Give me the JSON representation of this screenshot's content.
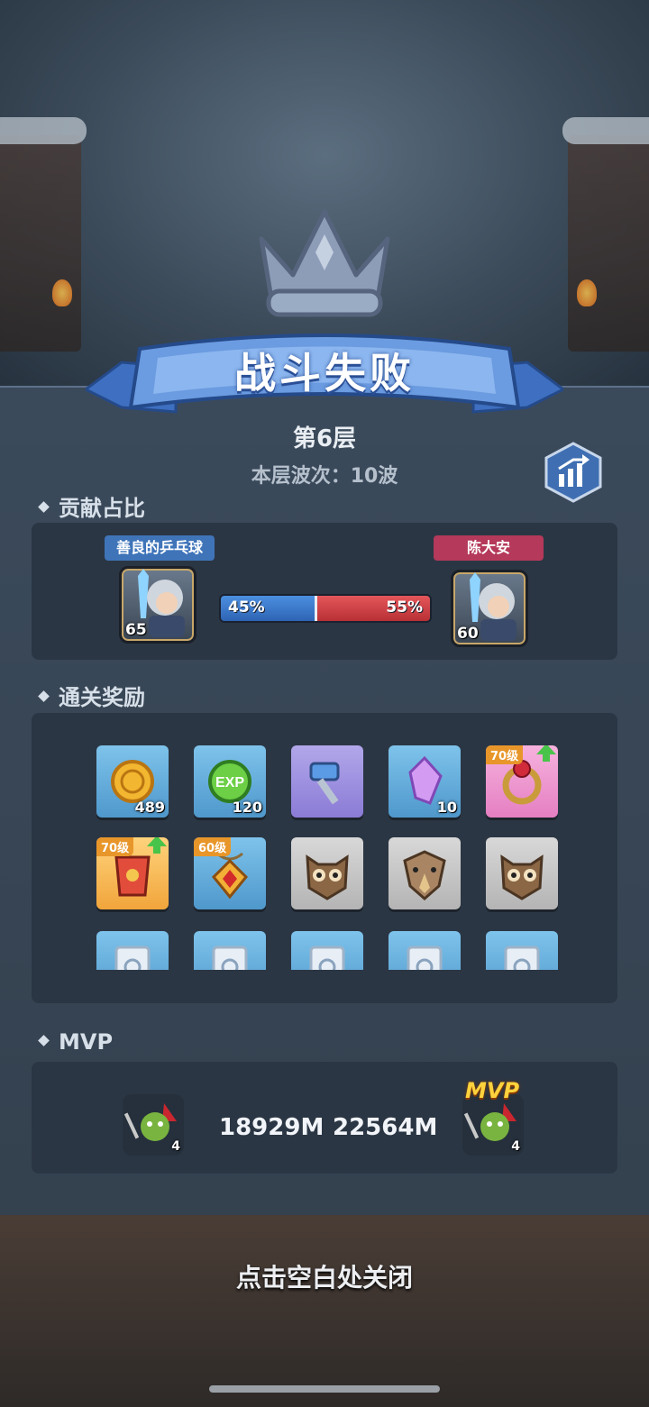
{
  "result": {
    "title": "战斗失败",
    "floor": "第6层",
    "waves": "本层波次：10波"
  },
  "contribution": {
    "section_title": "贡献占比",
    "left": {
      "name": "善良的乒乓球",
      "level": "65",
      "percent": "45%",
      "ratio": 0.45
    },
    "right": {
      "name": "陈大安",
      "level": "60",
      "percent": "55%"
    }
  },
  "rewards": {
    "section_title": "通关奖励",
    "items": [
      {
        "icon": "gold-coin-icon",
        "bg": "blue",
        "qty": "489"
      },
      {
        "icon": "exp-orb-icon",
        "bg": "blue",
        "qty": "120"
      },
      {
        "icon": "hammer-icon",
        "bg": "purple",
        "qty": ""
      },
      {
        "icon": "crystal-icon",
        "bg": "blue",
        "qty": "10"
      },
      {
        "icon": "ring-icon",
        "bg": "pink",
        "level": "70级",
        "upgrade": true
      },
      {
        "icon": "armor-icon",
        "bg": "gold",
        "level": "70级",
        "upgrade": true
      },
      {
        "icon": "amulet-icon",
        "bg": "blue",
        "level": "60级"
      },
      {
        "icon": "owl-mask-icon",
        "bg": "gray"
      },
      {
        "icon": "eagle-mask-icon",
        "bg": "gray"
      },
      {
        "icon": "owl-mask-icon",
        "bg": "gray"
      },
      {
        "icon": "scroll-icon",
        "bg": "blue"
      },
      {
        "icon": "scroll-icon",
        "bg": "blue"
      },
      {
        "icon": "scroll-icon",
        "bg": "blue"
      },
      {
        "icon": "scroll-icon",
        "bg": "blue"
      },
      {
        "icon": "scroll-icon",
        "bg": "blue"
      }
    ]
  },
  "mvp": {
    "section_title": "MVP",
    "left": {
      "count": "4",
      "damage": "18929M"
    },
    "right": {
      "count": "4",
      "damage": "22564M",
      "badge": "MVP"
    }
  },
  "close_hint": "点击空白处关闭",
  "colors": {
    "player_blue": "#3f74b9",
    "player_red": "#b5395a"
  }
}
